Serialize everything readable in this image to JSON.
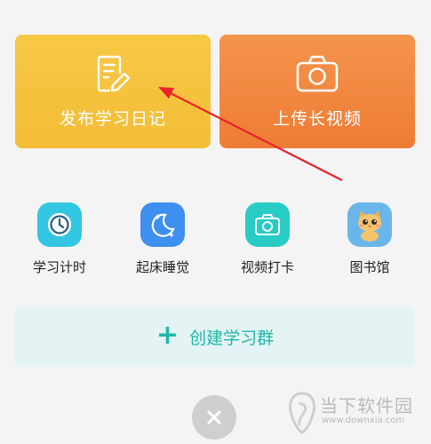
{
  "cards": {
    "diary_label": "发布学习日记",
    "video_label": "上传长视频"
  },
  "tools": [
    {
      "label": "学习计时",
      "icon": "clock-icon"
    },
    {
      "label": "起床睡觉",
      "icon": "moon-stars-icon"
    },
    {
      "label": "视频打卡",
      "icon": "camera-icon"
    },
    {
      "label": "图书馆",
      "icon": "cat-mascot-icon"
    }
  ],
  "group_button": {
    "label": "创建学习群",
    "icon": "plus-icon"
  },
  "close_button": {
    "icon": "close-icon"
  },
  "watermark": {
    "text": "当下软件园",
    "url": "www.downxia.com"
  },
  "colors": {
    "diary_card": "#f5c23e",
    "video_card": "#f08840",
    "accent_teal": "#1bb9a9",
    "annotation_arrow": "#e8232a"
  }
}
